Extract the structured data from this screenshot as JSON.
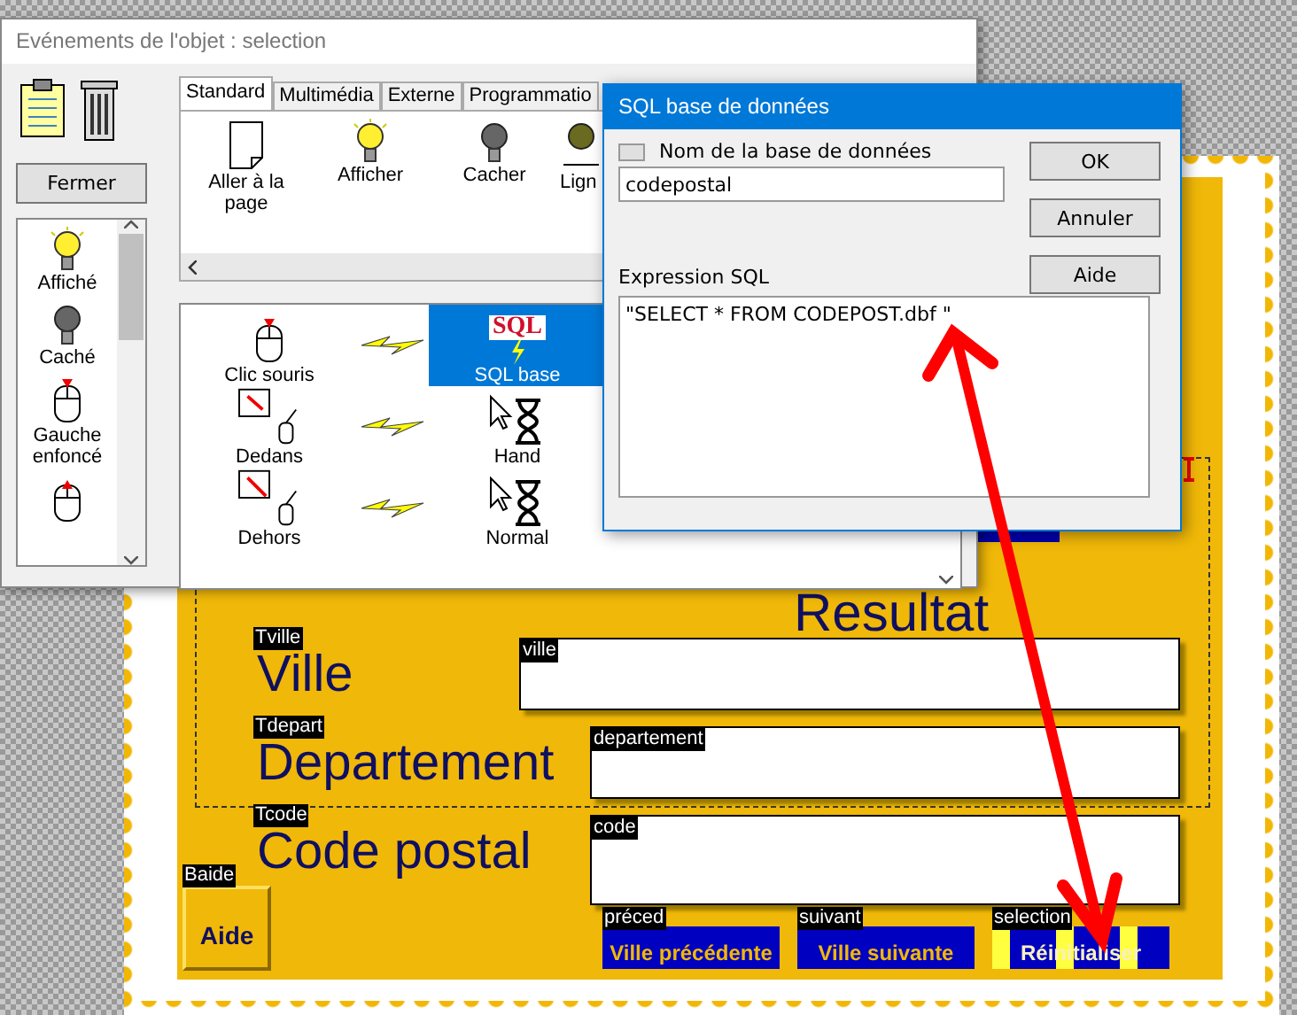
{
  "events_window": {
    "title": "Evénements de l'objet : selection",
    "close_button": "Fermer",
    "states": [
      {
        "kind": "lit",
        "label": "Affiché"
      },
      {
        "kind": "unlit",
        "label": "Caché"
      },
      {
        "kind": "press",
        "label": "Gauche enfoncé"
      },
      {
        "kind": "release"
      }
    ],
    "tabs": [
      {
        "label": "Standard",
        "selected": true
      },
      {
        "label": "Multimédia",
        "selected": false
      },
      {
        "label": "Externe",
        "selected": false
      },
      {
        "label": "Programmatio",
        "selected": false
      }
    ],
    "actions": [
      {
        "kind": "page",
        "label": "Aller à la page"
      },
      {
        "kind": "lit",
        "label": "Afficher"
      },
      {
        "kind": "unlit",
        "label": "Cacher"
      },
      {
        "kind": "line",
        "label": "Lign"
      }
    ],
    "rules": [
      {
        "event": {
          "kind": "click",
          "label": "Clic souris"
        },
        "action": {
          "kind": "sql",
          "badge": "SQL",
          "label": "SQL base"
        },
        "selected": true
      },
      {
        "event": {
          "kind": "inside",
          "label": "Dedans"
        },
        "action": {
          "kind": "cursor",
          "label": "Hand"
        },
        "selected": false
      },
      {
        "event": {
          "kind": "outside",
          "label": "Dehors"
        },
        "action": {
          "kind": "cursor",
          "label": "Normal"
        },
        "selected": false
      }
    ]
  },
  "sql_dialog": {
    "title": "SQL base de données",
    "database_checkbox": {
      "label": "Nom de la base de données",
      "checked": false
    },
    "database_name": "codepostal",
    "expression_label": "Expression SQL",
    "expression": "\"SELECT * FROM CODEPOST.dbf \"",
    "buttons": [
      "OK",
      "Annuler",
      "Aide"
    ]
  },
  "form": {
    "heading": "Resultat",
    "fields": [
      {
        "tag": "Tville",
        "label": "Ville",
        "field_tag": "ville"
      },
      {
        "tag": "Tdepart",
        "label": "Departement",
        "field_tag": "departement"
      },
      {
        "tag": "Tcode",
        "label": "Code postal",
        "field_tag": "code"
      }
    ],
    "help_button": {
      "tag": "Baide",
      "label": "Aide"
    },
    "buttons": [
      {
        "tag": "préced",
        "label": "Ville précédente",
        "kind": "plain"
      },
      {
        "tag": "suivant",
        "label": "Ville suivante",
        "kind": "plain"
      },
      {
        "tag": "selection",
        "label": "Réinitialiser",
        "kind": "striped"
      }
    ]
  }
}
